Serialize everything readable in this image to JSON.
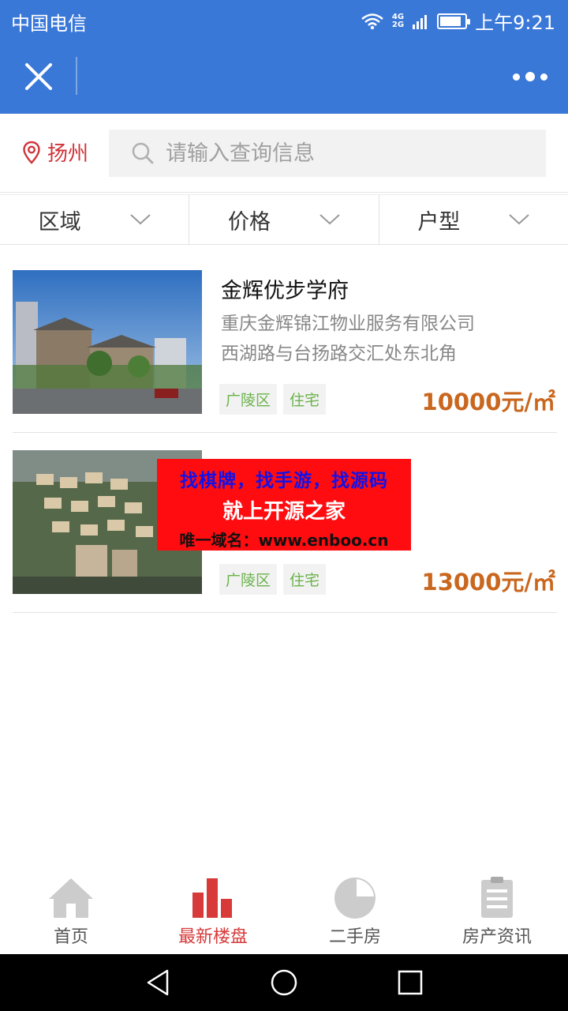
{
  "status_bar": {
    "carrier": "中国电信",
    "network": "4G",
    "network2": "2G",
    "time": "上午9:21",
    "battery_level": 0.85
  },
  "header": {
    "close_icon": "close-icon",
    "more_icon": "more-dots-icon"
  },
  "search": {
    "city": "扬州",
    "placeholder": "请输入查询信息"
  },
  "filters": [
    {
      "label": "区域"
    },
    {
      "label": "价格"
    },
    {
      "label": "户型"
    }
  ],
  "listings": [
    {
      "title": "金辉优步学府",
      "company": "重庆金辉锦江物业服务有限公司",
      "address": "西湖路与台扬路交汇处东北角",
      "tags": [
        "广陵区",
        "住宅"
      ],
      "price": "10000元/㎡"
    },
    {
      "title": "",
      "company": "",
      "address": "",
      "tags": [
        "广陵区",
        "住宅"
      ],
      "price": "13000元/㎡"
    }
  ],
  "ad": {
    "line1": "找棋牌，找手游，找源码",
    "line2": "就上开源之家",
    "line3": "唯一域名：www.enboo.cn"
  },
  "tabs": [
    {
      "label": "首页",
      "icon": "home-icon"
    },
    {
      "label": "最新楼盘",
      "icon": "bar-chart-icon"
    },
    {
      "label": "二手房",
      "icon": "pie-chart-icon"
    },
    {
      "label": "房产资讯",
      "icon": "clipboard-icon"
    }
  ],
  "colors": {
    "primary": "#3a78d8",
    "accent_red": "#d83a3a",
    "price": "#c9671f",
    "tag_text": "#6ab34a",
    "tab_inactive": "#cccccc"
  }
}
